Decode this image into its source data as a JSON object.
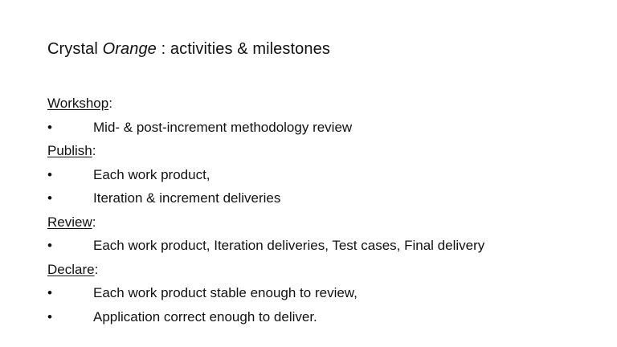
{
  "slide": {
    "title": {
      "part1": "Crystal ",
      "part2_italic": "Orange",
      "part3": " : activities & milestones"
    },
    "bullet_glyph": "•",
    "sections": [
      {
        "heading": "Workshop",
        "colon": ":",
        "items": [
          "Mid- & post-increment methodology review"
        ]
      },
      {
        "heading": "Publish",
        "colon": ":",
        "items": [
          "Each work product,",
          "Iteration & increment deliveries"
        ]
      },
      {
        "heading": "Review",
        "colon": ":",
        "items": [
          "Each work product, Iteration deliveries, Test cases, Final delivery"
        ]
      },
      {
        "heading": "Declare",
        "colon": ":",
        "items": [
          "Each work product stable enough to review,",
          "Application correct enough to deliver."
        ]
      }
    ]
  }
}
